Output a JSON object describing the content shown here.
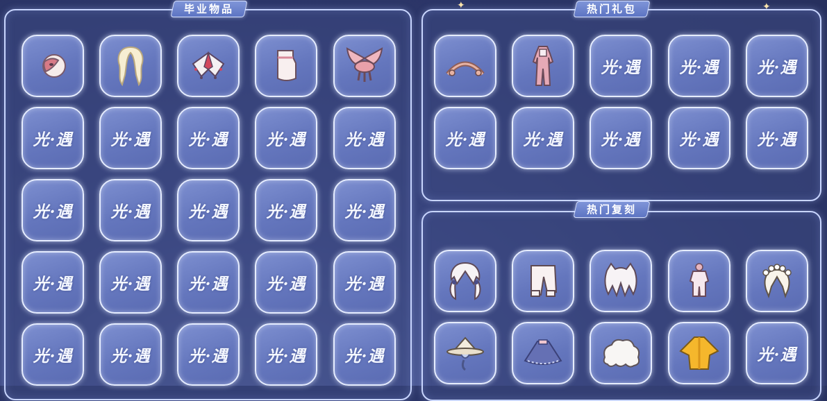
{
  "sections": {
    "graduation": {
      "title": "毕业物品"
    },
    "hot_gifts": {
      "title": "热门礼包"
    },
    "hot_reprints": {
      "title": "热门复刻"
    }
  },
  "placeholder_label": "光·遇",
  "graduation_items": [
    {
      "icon": "mask-icon"
    },
    {
      "icon": "long-hair-icon"
    },
    {
      "icon": "cape-icon"
    },
    {
      "icon": "boots-icon"
    },
    {
      "icon": "winged-headpiece-icon"
    }
  ],
  "gift_items": [
    {
      "icon": "headband-icon"
    },
    {
      "icon": "outfit-icon"
    }
  ],
  "reprint_items": [
    {
      "icon": "twin-tail-hair-icon"
    },
    {
      "icon": "pants-icon"
    },
    {
      "icon": "cat-ear-hair-icon"
    },
    {
      "icon": "small-outfit-icon"
    },
    {
      "icon": "flower-crown-hair-icon"
    },
    {
      "icon": "straw-hat-icon"
    },
    {
      "icon": "blue-cape-icon"
    },
    {
      "icon": "curly-hair-icon"
    },
    {
      "icon": "yellow-cape-icon"
    }
  ]
}
